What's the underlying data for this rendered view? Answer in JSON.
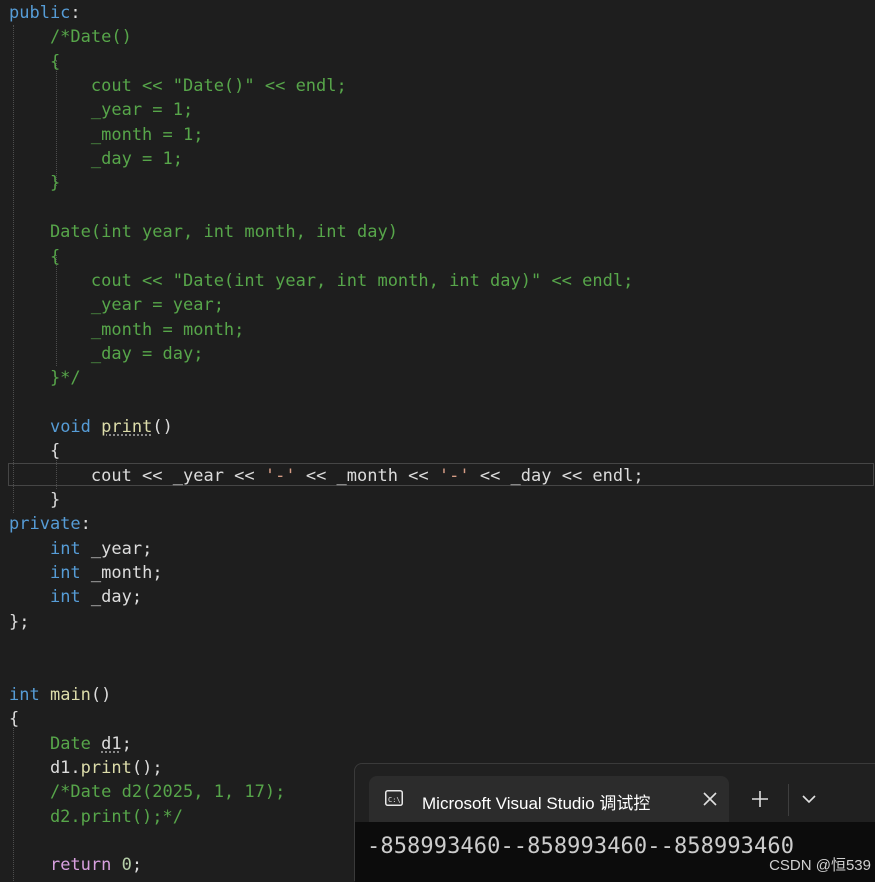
{
  "code": {
    "lines": [
      [
        [
          "kw",
          "public"
        ],
        [
          "pl",
          ":"
        ]
      ],
      [
        [
          "cmt",
          "    /*Date()"
        ]
      ],
      [
        [
          "cmt",
          "    {"
        ]
      ],
      [
        [
          "cmt",
          "        cout << \"Date()\" << endl;"
        ]
      ],
      [
        [
          "cmt",
          "        _year = 1;"
        ]
      ],
      [
        [
          "cmt",
          "        _month = 1;"
        ]
      ],
      [
        [
          "cmt",
          "        _day = 1;"
        ]
      ],
      [
        [
          "cmt",
          "    }"
        ]
      ],
      [],
      [
        [
          "cmt",
          "    Date(int year, int month, int day)"
        ]
      ],
      [
        [
          "cmt",
          "    {"
        ]
      ],
      [
        [
          "cmt",
          "        cout << \"Date(int year, int month, int day)\" << endl;"
        ]
      ],
      [
        [
          "cmt",
          "        _year = year;"
        ]
      ],
      [
        [
          "cmt",
          "        _month = month;"
        ]
      ],
      [
        [
          "cmt",
          "        _day = day;"
        ]
      ],
      [
        [
          "cmt",
          "    }*/"
        ]
      ],
      [],
      [
        [
          "pl",
          "    "
        ],
        [
          "kw",
          "void"
        ],
        [
          "pl",
          " "
        ],
        [
          "fn u",
          "print"
        ],
        [
          "pl",
          "()"
        ]
      ],
      [
        [
          "pl",
          "    {"
        ]
      ],
      [
        [
          "pl",
          "        cout << _year << "
        ],
        [
          "str",
          "'-'"
        ],
        [
          "pl",
          " << _month << "
        ],
        [
          "str",
          "'-'"
        ],
        [
          "pl",
          " << _day << endl;"
        ]
      ],
      [
        [
          "pl",
          "    }"
        ]
      ],
      [
        [
          "kw",
          "private"
        ],
        [
          "pl",
          ":"
        ]
      ],
      [
        [
          "pl",
          "    "
        ],
        [
          "kw",
          "int"
        ],
        [
          "pl",
          " _year;"
        ]
      ],
      [
        [
          "pl",
          "    "
        ],
        [
          "kw",
          "int"
        ],
        [
          "pl",
          " _month;"
        ]
      ],
      [
        [
          "pl",
          "    "
        ],
        [
          "kw",
          "int"
        ],
        [
          "pl",
          " _day;"
        ]
      ],
      [
        [
          "pl",
          "};"
        ]
      ],
      [],
      [],
      [
        [
          "kw",
          "int"
        ],
        [
          "pl",
          " "
        ],
        [
          "fn",
          "main"
        ],
        [
          "pl",
          "()"
        ]
      ],
      [
        [
          "pl",
          "{"
        ]
      ],
      [
        [
          "pl",
          "    "
        ],
        [
          "cmt",
          "Date"
        ],
        [
          "pl",
          " "
        ],
        [
          "pl u",
          "d1"
        ],
        [
          "pl",
          ";"
        ]
      ],
      [
        [
          "pl",
          "    d1."
        ],
        [
          "fn",
          "print"
        ],
        [
          "pl",
          "();"
        ]
      ],
      [
        [
          "cmt",
          "    /*Date d2(2025, 1, 17);"
        ]
      ],
      [
        [
          "cmt",
          "    d2.print();*/"
        ]
      ],
      [],
      [
        [
          "pl",
          "    "
        ],
        [
          "ctl",
          "return"
        ],
        [
          "pl",
          " "
        ],
        [
          "num",
          "0"
        ],
        [
          "pl",
          ";"
        ]
      ]
    ]
  },
  "terminal": {
    "tab_title": "Microsoft Visual Studio 调试控",
    "output": "-858993460--858993460--858993460",
    "icon": "console-icon",
    "close_icon": "close-icon",
    "new_tab_icon": "plus-icon",
    "dropdown_icon": "chevron-down-icon"
  },
  "watermark": "CSDN @恒539",
  "colors": {
    "background": "#1e1e1e",
    "keyword": "#569cd6",
    "comment": "#57a64a",
    "function": "#dcdcaa",
    "string": "#d69d85",
    "control": "#d8a0df"
  }
}
